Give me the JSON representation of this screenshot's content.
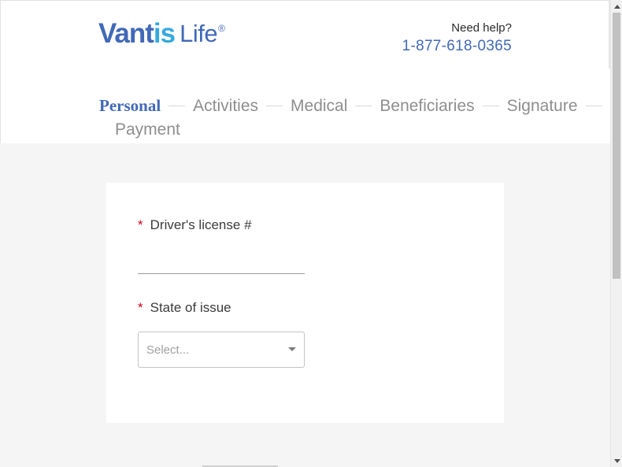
{
  "header": {
    "logo": {
      "brand_part1": "Vant",
      "brand_part2": "is",
      "brand_part3": "Life",
      "registered": "®"
    },
    "help_label": "Need help?",
    "phone": "1-877-618-0365"
  },
  "steps": [
    {
      "label": "Personal",
      "active": true
    },
    {
      "label": "Activities",
      "active": false
    },
    {
      "label": "Medical",
      "active": false
    },
    {
      "label": "Beneficiaries",
      "active": false
    },
    {
      "label": "Signature",
      "active": false
    },
    {
      "label": "Payment",
      "active": false
    }
  ],
  "form": {
    "required_marker": "*",
    "drivers_license": {
      "label": "Driver's license #",
      "value": ""
    },
    "state_of_issue": {
      "label": "State of issue",
      "placeholder": "Select..."
    }
  },
  "colors": {
    "brand_blue": "#4169b8",
    "brand_light_blue": "#35a9de",
    "required_red": "#d0021b",
    "inactive_step": "#8e8e8e",
    "page_bg": "#f5f5f5"
  },
  "icons": {
    "select_caret": "chevron-down-icon",
    "scroll_up": "arrow-up-icon",
    "scroll_down": "arrow-down-icon"
  }
}
